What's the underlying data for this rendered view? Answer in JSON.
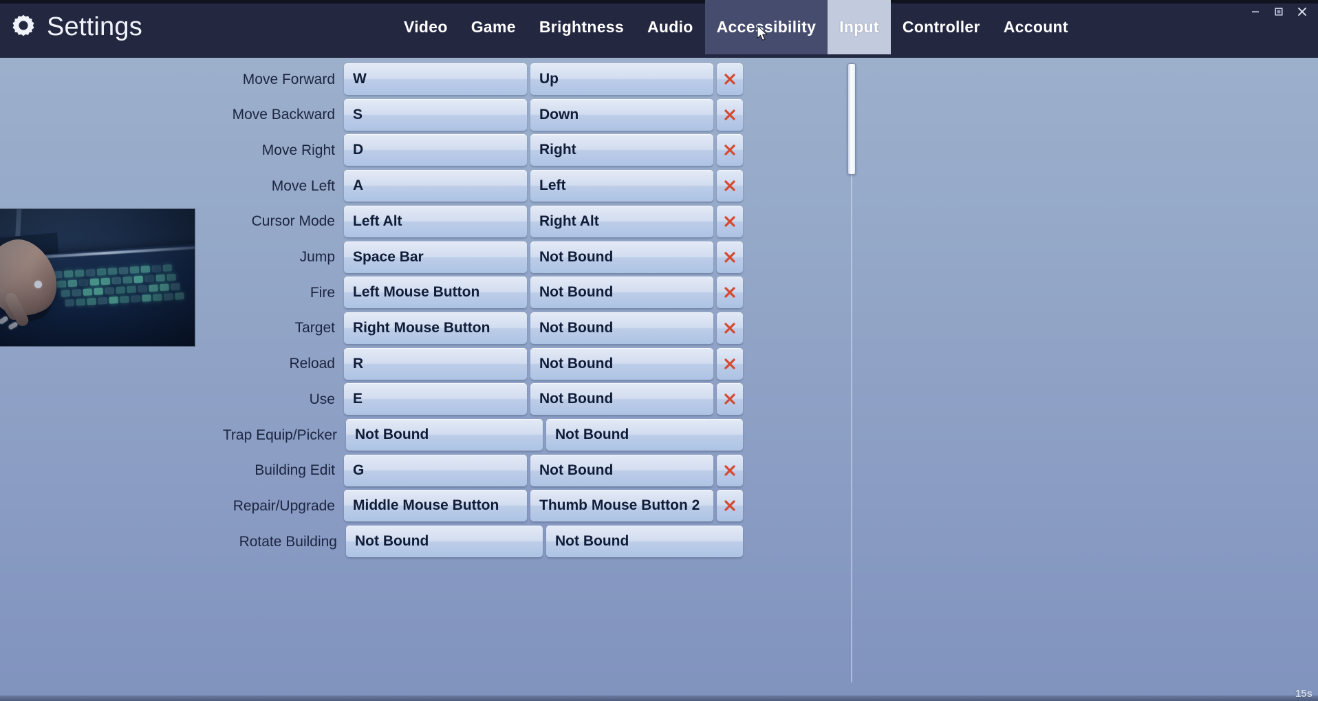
{
  "window": {
    "title": "Settings",
    "gear_icon": "gear-icon",
    "controls": [
      {
        "name": "minimize-button",
        "glyph": "minimize-icon"
      },
      {
        "name": "maximize-button",
        "glyph": "maximize-icon"
      },
      {
        "name": "close-button",
        "glyph": "close-icon"
      }
    ]
  },
  "tabs": [
    {
      "label": "Video",
      "state": "normal"
    },
    {
      "label": "Game",
      "state": "normal"
    },
    {
      "label": "Brightness",
      "state": "normal"
    },
    {
      "label": "Audio",
      "state": "normal"
    },
    {
      "label": "Accessibility",
      "state": "hover"
    },
    {
      "label": "Input",
      "state": "active"
    },
    {
      "label": "Controller",
      "state": "normal"
    },
    {
      "label": "Account",
      "state": "normal"
    }
  ],
  "keybinds": {
    "unbound_text": "Not Bound",
    "clear_icon": "close-x-icon",
    "rows": [
      {
        "label": "Move Forward",
        "primary": "W",
        "secondary": "Up",
        "clearable": true
      },
      {
        "label": "Move Backward",
        "primary": "S",
        "secondary": "Down",
        "clearable": true
      },
      {
        "label": "Move Right",
        "primary": "D",
        "secondary": "Right",
        "clearable": true
      },
      {
        "label": "Move Left",
        "primary": "A",
        "secondary": "Left",
        "clearable": true
      },
      {
        "label": "Cursor Mode",
        "primary": "Left Alt",
        "secondary": "Right Alt",
        "clearable": true
      },
      {
        "label": "Jump",
        "primary": "Space Bar",
        "secondary": "Not Bound",
        "clearable": true
      },
      {
        "label": "Fire",
        "primary": "Left Mouse Button",
        "secondary": "Not Bound",
        "clearable": true
      },
      {
        "label": "Target",
        "primary": "Right Mouse Button",
        "secondary": "Not Bound",
        "clearable": true
      },
      {
        "label": "Reload",
        "primary": "R",
        "secondary": "Not Bound",
        "clearable": true
      },
      {
        "label": "Use",
        "primary": "E",
        "secondary": "Not Bound",
        "clearable": true
      },
      {
        "label": "Trap Equip/Picker",
        "primary": "Not Bound",
        "secondary": "Not Bound",
        "clearable": false
      },
      {
        "label": "Building Edit",
        "primary": "G",
        "secondary": "Not Bound",
        "clearable": true
      },
      {
        "label": "Repair/Upgrade",
        "primary": "Middle Mouse Button",
        "secondary": "Thumb Mouse Button 2",
        "clearable": true
      },
      {
        "label": "Rotate Building",
        "primary": "Not Bound",
        "secondary": "Not Bound",
        "clearable": false
      }
    ]
  },
  "scrollbar": {
    "name": "vertical-scrollbar",
    "thumb_position_pct": 0,
    "thumb_size_pct": 18
  },
  "overlay": {
    "webcam_label": "webcam-feed",
    "clip_timer": "15s"
  },
  "colors": {
    "titlebar": "#232740",
    "active_tab_bg": "#c2cade",
    "hover_tab_bg": "#464c6d",
    "body_top": "#9cb0cc",
    "body_bottom": "#8093be",
    "bind_text": "#101c38",
    "label_text": "#1b2440",
    "clear_x": "#d34a2f"
  }
}
